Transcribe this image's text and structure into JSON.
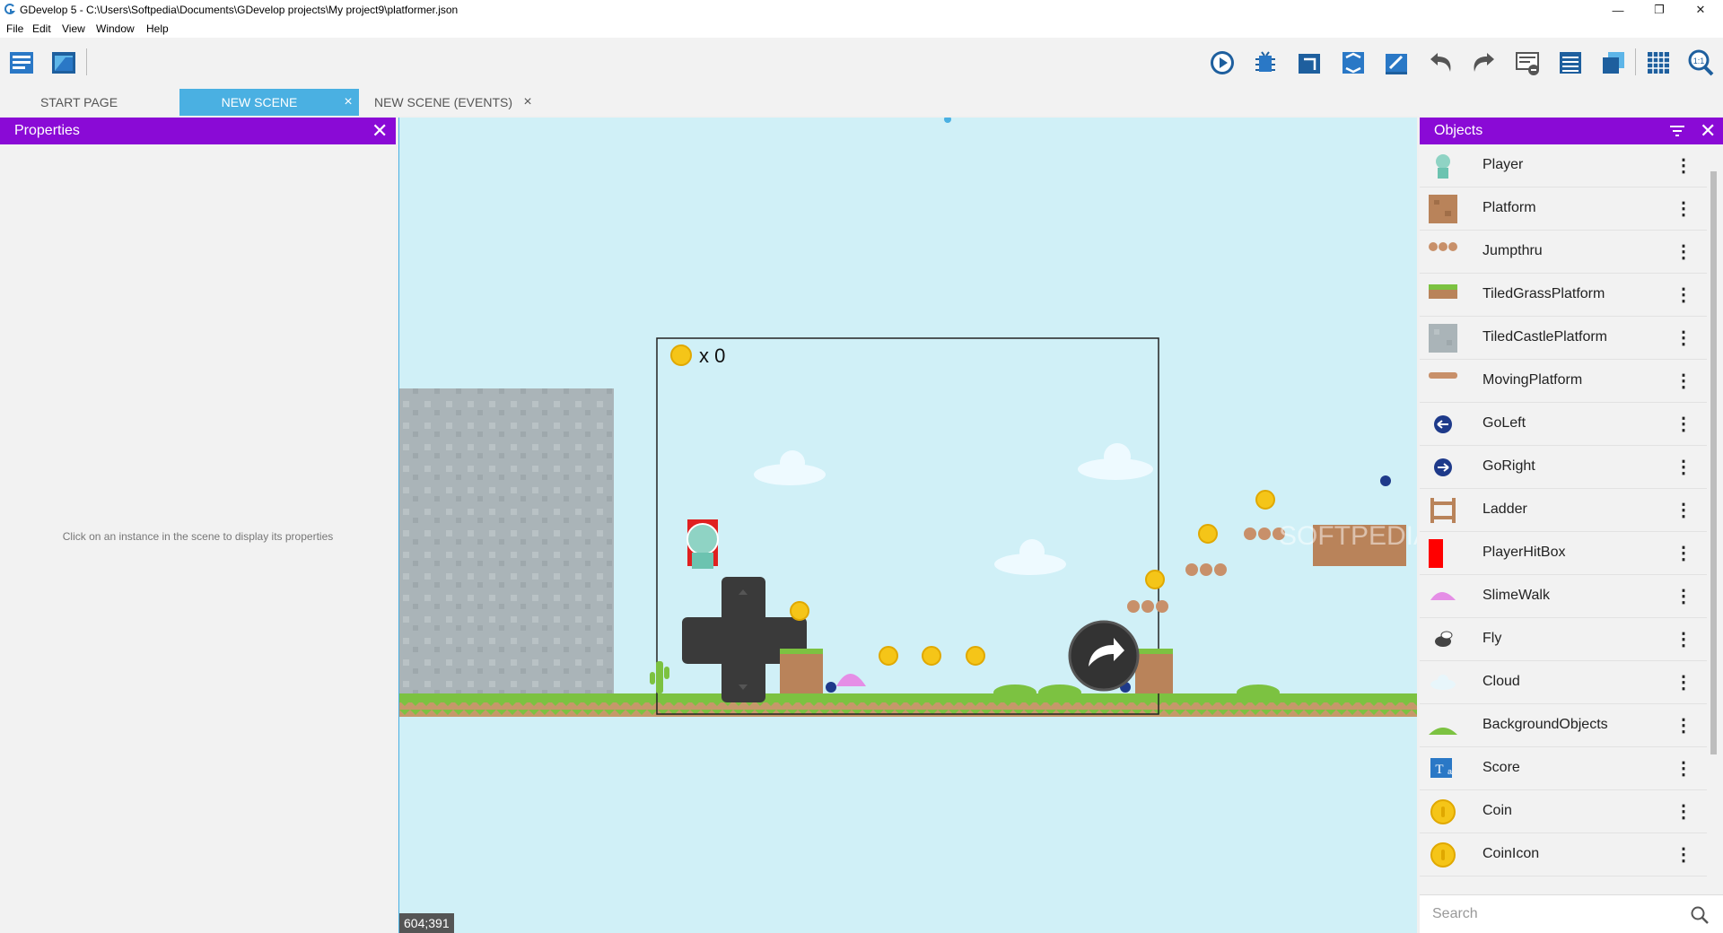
{
  "window": {
    "title": "GDevelop 5 - C:\\Users\\Softpedia\\Documents\\GDevelop projects\\My project9\\platformer.json",
    "minimize": "—",
    "maximize": "❐",
    "close": "✕"
  },
  "menu": [
    "File",
    "Edit",
    "View",
    "Window",
    "Help"
  ],
  "tabs": [
    {
      "label": "START PAGE",
      "active": false
    },
    {
      "label": "NEW SCENE",
      "active": true
    },
    {
      "label": "NEW SCENE (EVENTS)",
      "active": false
    }
  ],
  "tab_close": "×",
  "properties": {
    "title": "Properties",
    "hint": "Click on an instance in the scene to display its properties",
    "close": "✕"
  },
  "scene": {
    "coords": "604;391",
    "hud_count": "x 0",
    "watermark": "SOFTPEDIA",
    "colors": {
      "sky": "#d0f0f7",
      "grass": "#7cc241",
      "dirt": "#c6986a",
      "stone": "#aab4b8"
    }
  },
  "objects": {
    "title": "Objects",
    "close": "✕",
    "search_placeholder": "Search",
    "items": [
      {
        "label": "Player",
        "icon": "player-icon"
      },
      {
        "label": "Platform",
        "icon": "platform-icon"
      },
      {
        "label": "Jumpthru",
        "icon": "jumpthru-icon"
      },
      {
        "label": "TiledGrassPlatform",
        "icon": "grass-platform-icon"
      },
      {
        "label": "TiledCastlePlatform",
        "icon": "castle-platform-icon"
      },
      {
        "label": "MovingPlatform",
        "icon": "moving-platform-icon"
      },
      {
        "label": "GoLeft",
        "icon": "go-left-icon"
      },
      {
        "label": "GoRight",
        "icon": "go-right-icon"
      },
      {
        "label": "Ladder",
        "icon": "ladder-icon"
      },
      {
        "label": "PlayerHitBox",
        "icon": "hitbox-icon"
      },
      {
        "label": "SlimeWalk",
        "icon": "slime-icon"
      },
      {
        "label": "Fly",
        "icon": "fly-icon"
      },
      {
        "label": "Cloud",
        "icon": "cloud-icon"
      },
      {
        "label": "BackgroundObjects",
        "icon": "bush-icon"
      },
      {
        "label": "Score",
        "icon": "text-icon"
      },
      {
        "label": "Coin",
        "icon": "coin-icon"
      },
      {
        "label": "CoinIcon",
        "icon": "coin-icon"
      }
    ]
  },
  "colors": {
    "accent_purple": "#8a0ad6",
    "tab_blue": "#4ab0e2"
  }
}
